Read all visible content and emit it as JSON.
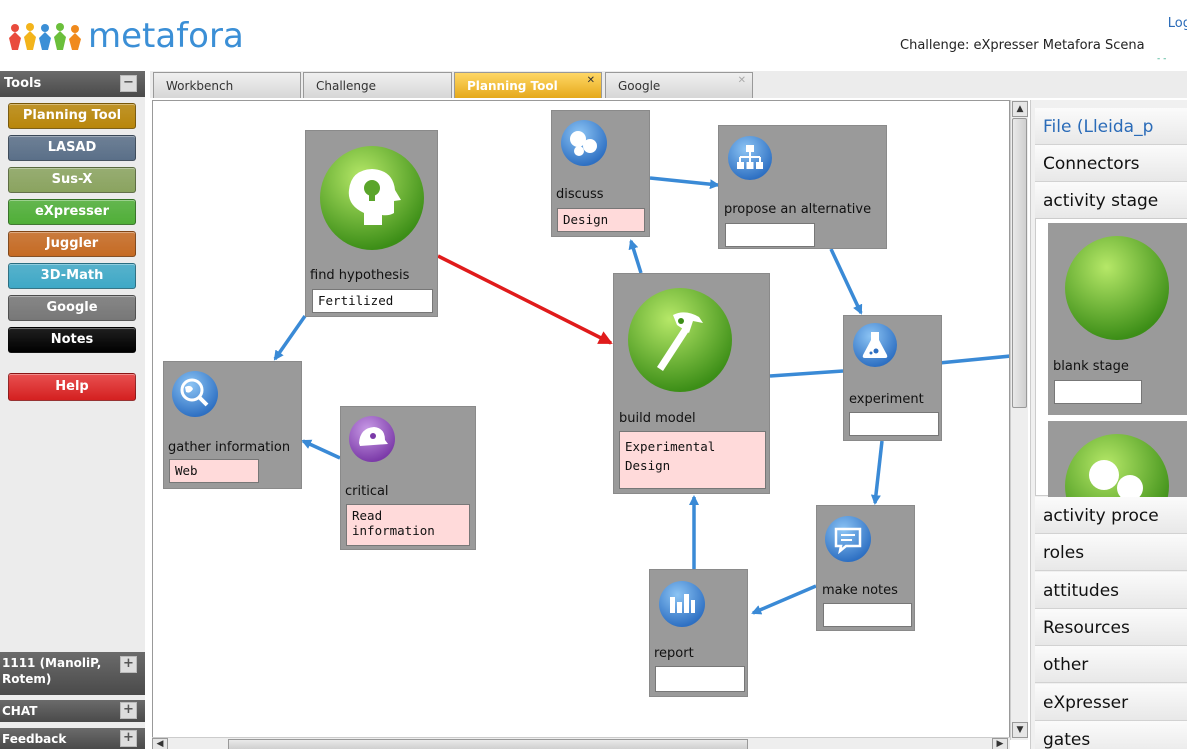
{
  "header": {
    "logo_text": "metafora",
    "login_text": "Log",
    "challenge_text": "Challenge: eXpresser Metafora Scena",
    "sub_text": "- -"
  },
  "sidebar": {
    "tools_title": "Tools",
    "tools_toggle": "−",
    "tools": [
      {
        "label": "Planning Tool",
        "color": "#b8860b"
      },
      {
        "label": "LASAD",
        "color": "#5a6f88"
      },
      {
        "label": "Sus-X",
        "color": "#8aa35f"
      },
      {
        "label": "eXpresser",
        "color": "#4fae37"
      },
      {
        "label": "Juggler",
        "color": "#c56a23"
      },
      {
        "label": "3D-Math",
        "color": "#3fa8c6"
      },
      {
        "label": "Google",
        "color": "#777777"
      },
      {
        "label": "Notes",
        "color": "#000000"
      }
    ],
    "help_label": "Help",
    "help_color": "#d42020",
    "group_label": "1111 (ManoliP, Rotem)",
    "chat_label": "CHAT",
    "feedback_label": "Feedback",
    "expand_icon": "+"
  },
  "tabs": [
    {
      "label": "Workbench",
      "active": false
    },
    {
      "label": "Challenge",
      "active": false
    },
    {
      "label": "Planning Tool",
      "active": true
    },
    {
      "label": "Google",
      "active": false
    }
  ],
  "tab_close_glyph": "✕",
  "nodes": {
    "find_hypothesis": {
      "label": "find hypothesis",
      "value": "Fertilized"
    },
    "discuss": {
      "label": "discuss",
      "value": "Design"
    },
    "propose": {
      "label": "propose an alternative",
      "value": ""
    },
    "gather": {
      "label": "gather information",
      "value": "Web"
    },
    "critical": {
      "label": "critical",
      "value": "Read information"
    },
    "build_model": {
      "label": "build model",
      "value": "Experimental Design"
    },
    "experiment": {
      "label": "experiment",
      "value": ""
    },
    "make_notes": {
      "label": "make notes",
      "value": ""
    },
    "report": {
      "label": "report",
      "value": ""
    }
  },
  "palette": {
    "file_label": "File (Lleida_p",
    "connectors_label": "Connectors",
    "activity_stages_label": "activity stage",
    "blank_stage_label": "blank stage",
    "rows": [
      "activity proce",
      "roles",
      "attitudes",
      "Resources",
      "other",
      "eXpresser",
      "gates"
    ]
  },
  "colors": {
    "arrow_blue": "#3a8ad6",
    "arrow_red": "#e01b1b",
    "node_gray": "#9a9a9a",
    "pink_field": "#ffdada",
    "tab_active": "#e5a91a"
  }
}
